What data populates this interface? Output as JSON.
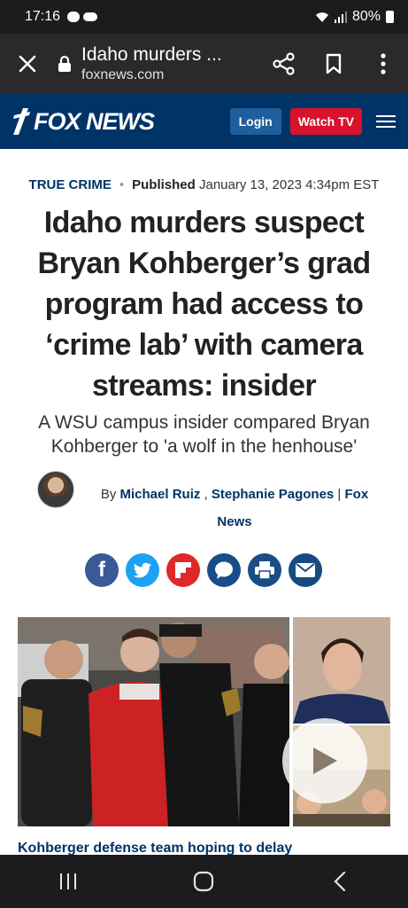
{
  "status_bar": {
    "time": "17:16",
    "battery": "80%"
  },
  "browser": {
    "title": "Idaho murders ...",
    "domain": "foxnews.com"
  },
  "header": {
    "logo": "FOX NEWS",
    "login": "Login",
    "watch_tv": "Watch TV"
  },
  "article": {
    "category": "TRUE CRIME",
    "published_label": "Published",
    "published_date": "January 13, 2023 4:34pm EST",
    "headline": "Idaho murders suspect Bryan Kohberger’s grad program had access to ‘crime lab’ with camera streams: insider",
    "subhead": "A WSU campus insider compared Bryan Kohberger to 'a wolf in the henhouse'",
    "by": "By",
    "author1": "Michael Ruiz",
    "comma": " , ",
    "author2": "Stephanie Pagones",
    "sep": " | ",
    "outlet": "Fox News",
    "caption": "Kohberger defense team hoping to delay"
  },
  "share": {
    "facebook": "f",
    "twitter": "t",
    "flipboard": "F",
    "comments": "",
    "print": "",
    "email": ""
  },
  "colors": {
    "fox_blue": "#003366",
    "watch_red": "#d8112d",
    "login_blue": "#1f5f9e"
  },
  "icons": [
    "close-icon",
    "lock-icon",
    "share-icon",
    "bookmark-icon",
    "more-icon",
    "menu-icon",
    "play-icon",
    "recents-icon",
    "home-icon",
    "back-icon"
  ]
}
